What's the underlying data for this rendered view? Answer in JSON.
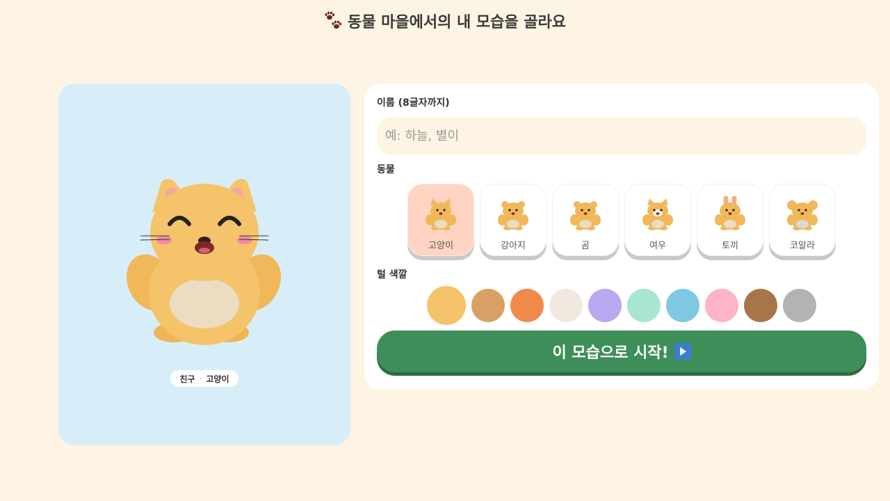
{
  "header": {
    "title": "동물 마을에서의 내 모습을 골라요",
    "icon": "paw-prints-icon"
  },
  "preview": {
    "background": "#d7eef8",
    "caption_role": "친구",
    "caption_sep": "·",
    "caption_animal": "고양이",
    "fur_color": "#f5c36a"
  },
  "form": {
    "name_label": "이름 (8글자까지)",
    "name_placeholder": "예: 하늘, 별이",
    "name_value": "",
    "animal_label": "동물",
    "animals": [
      {
        "name": "고양이",
        "selected": true
      },
      {
        "name": "강아지",
        "selected": false
      },
      {
        "name": "곰",
        "selected": false
      },
      {
        "name": "여우",
        "selected": false
      },
      {
        "name": "토끼",
        "selected": false
      },
      {
        "name": "코알라",
        "selected": false
      }
    ],
    "color_label": "털 색깔",
    "colors": [
      "#f5c36a",
      "#d9a066",
      "#f08a4b",
      "#f1e9df",
      "#b9a7f2",
      "#a8e6cf",
      "#7ec8e3",
      "#ffb3c8",
      "#a8754a",
      "#b3b3b3"
    ],
    "selected_color_index": 0,
    "start_label": "이 모습으로 시작!",
    "start_icon": "play-icon"
  }
}
